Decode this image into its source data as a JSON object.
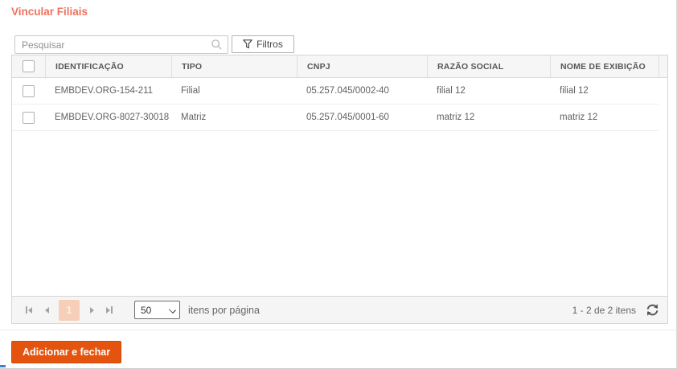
{
  "page": {
    "title": "Vincular Filiais"
  },
  "toolbar": {
    "search_placeholder": "Pesquisar",
    "search_value": "",
    "filters_label": "Filtros"
  },
  "table": {
    "columns": [
      "IDENTIFICAÇÃO",
      "TIPO",
      "CNPJ",
      "RAZÃO SOCIAL",
      "NOME DE EXIBIÇÃO"
    ],
    "rows": [
      {
        "identificacao": "EMBDEV.ORG-154-211",
        "tipo": "Filial",
        "cnpj": "05.257.045/0002-40",
        "razao_social": "filial 12",
        "nome_exibicao": "filial 12"
      },
      {
        "identificacao": "EMBDEV.ORG-8027-30018",
        "tipo": "Matriz",
        "cnpj": "05.257.045/0001-60",
        "razao_social": "matriz 12",
        "nome_exibicao": "matriz 12"
      }
    ]
  },
  "pager": {
    "current_page": "1",
    "page_size": "50",
    "page_size_label": "itens por página",
    "range_label": "1 - 2 de 2 itens"
  },
  "footer": {
    "submit_label": "Adicionar e fechar"
  },
  "icons": {
    "search": "search-icon",
    "filter": "filter-icon",
    "refresh": "refresh-icon"
  },
  "colors": {
    "accent_button": "#e5540e",
    "title": "#ed7360",
    "selected_page_bg": "#f7cfb9",
    "header_bg": "#f6f6f6",
    "pager_bg": "#f5f5f5"
  }
}
